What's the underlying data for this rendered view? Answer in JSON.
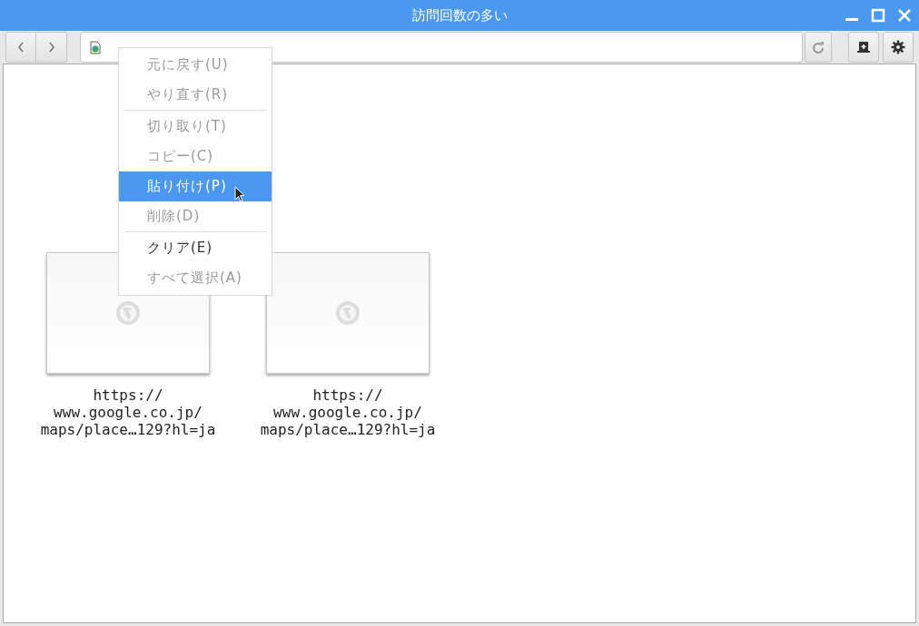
{
  "window": {
    "title": "訪問回数の多い"
  },
  "context_menu": [
    {
      "kind": "item",
      "label": "元に戻す(U)",
      "disabled": true,
      "selected": false
    },
    {
      "kind": "item",
      "label": "やり直す(R)",
      "disabled": true,
      "selected": false
    },
    {
      "kind": "separator"
    },
    {
      "kind": "item",
      "label": "切り取り(T)",
      "disabled": true,
      "selected": false
    },
    {
      "kind": "item",
      "label": "コピー(C)",
      "disabled": true,
      "selected": false
    },
    {
      "kind": "item",
      "label": "貼り付け(P)",
      "disabled": false,
      "selected": true
    },
    {
      "kind": "item",
      "label": "削除(D)",
      "disabled": true,
      "selected": false
    },
    {
      "kind": "separator"
    },
    {
      "kind": "item",
      "label": "クリア(E)",
      "disabled": false,
      "selected": false
    },
    {
      "kind": "item",
      "label": "すべて選択(A)",
      "disabled": true,
      "selected": false
    }
  ],
  "tiles": [
    {
      "caption_lines": [
        "https://",
        "www.google.co.jp/",
        "maps/place…129?hl=ja"
      ]
    },
    {
      "caption_lines": [
        "https://",
        "www.google.co.jp/",
        "maps/place…129?hl=ja"
      ]
    }
  ]
}
